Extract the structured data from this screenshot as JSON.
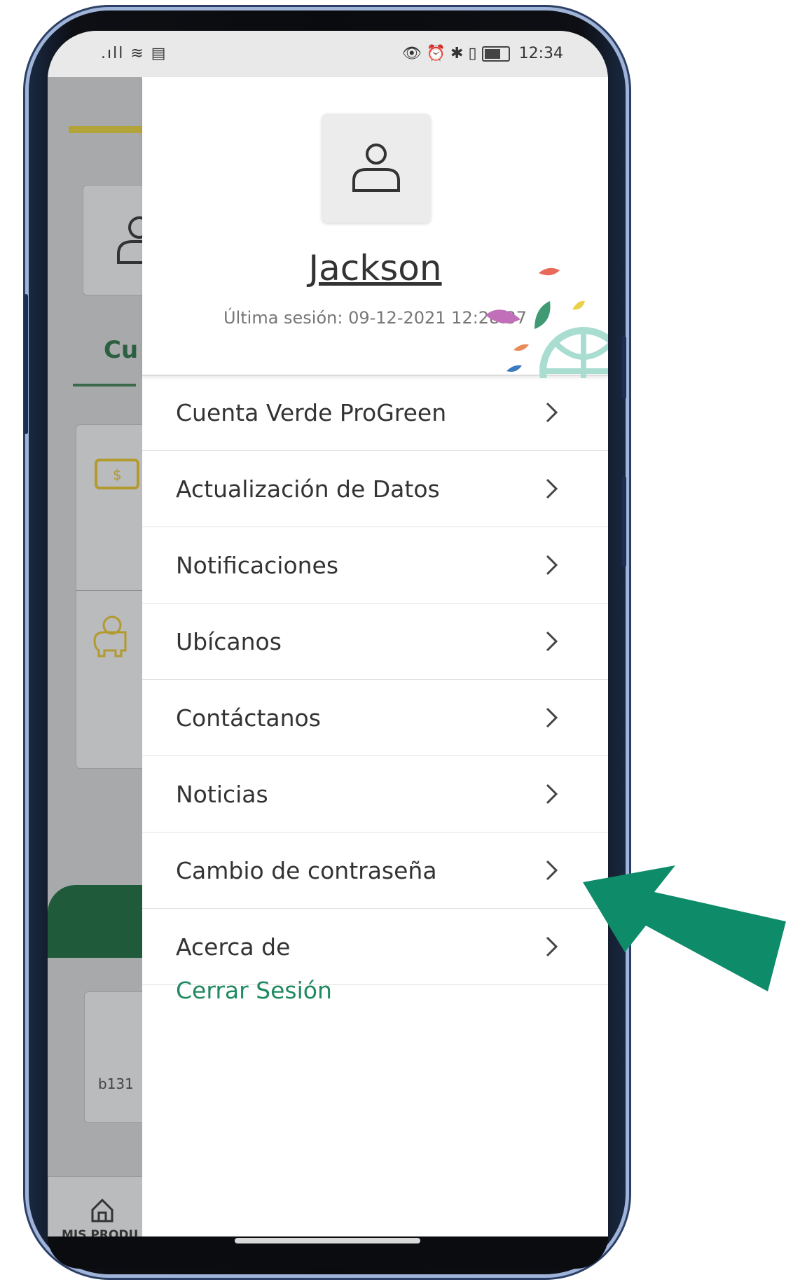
{
  "status_bar": {
    "left_icons": ".ıll ≋ ▤",
    "right_icons": "👁 ⏰ ✱ ▯",
    "time": "12:34"
  },
  "background_app": {
    "tab_fragment": "Cu",
    "card_value_fragment": "b131",
    "bottom_nav_label": "MIS PRODU"
  },
  "drawer": {
    "user_name": "Jackson",
    "last_session": "Última sesión: 09-12-2021 12:28:37",
    "menu": [
      {
        "label": "Cuenta Verde ProGreen"
      },
      {
        "label": "Actualización de Datos"
      },
      {
        "label": "Notificaciones"
      },
      {
        "label": "Ubícanos"
      },
      {
        "label": "Contáctanos"
      },
      {
        "label": "Noticias"
      },
      {
        "label": "Cambio de contraseña"
      },
      {
        "label": "Acerca de"
      }
    ],
    "logout_label": "Cerrar Sesión"
  },
  "colors": {
    "accent_green": "#1f8a61",
    "arrow_green": "#0e8c6a",
    "dark_green": "#1f5b3a"
  }
}
